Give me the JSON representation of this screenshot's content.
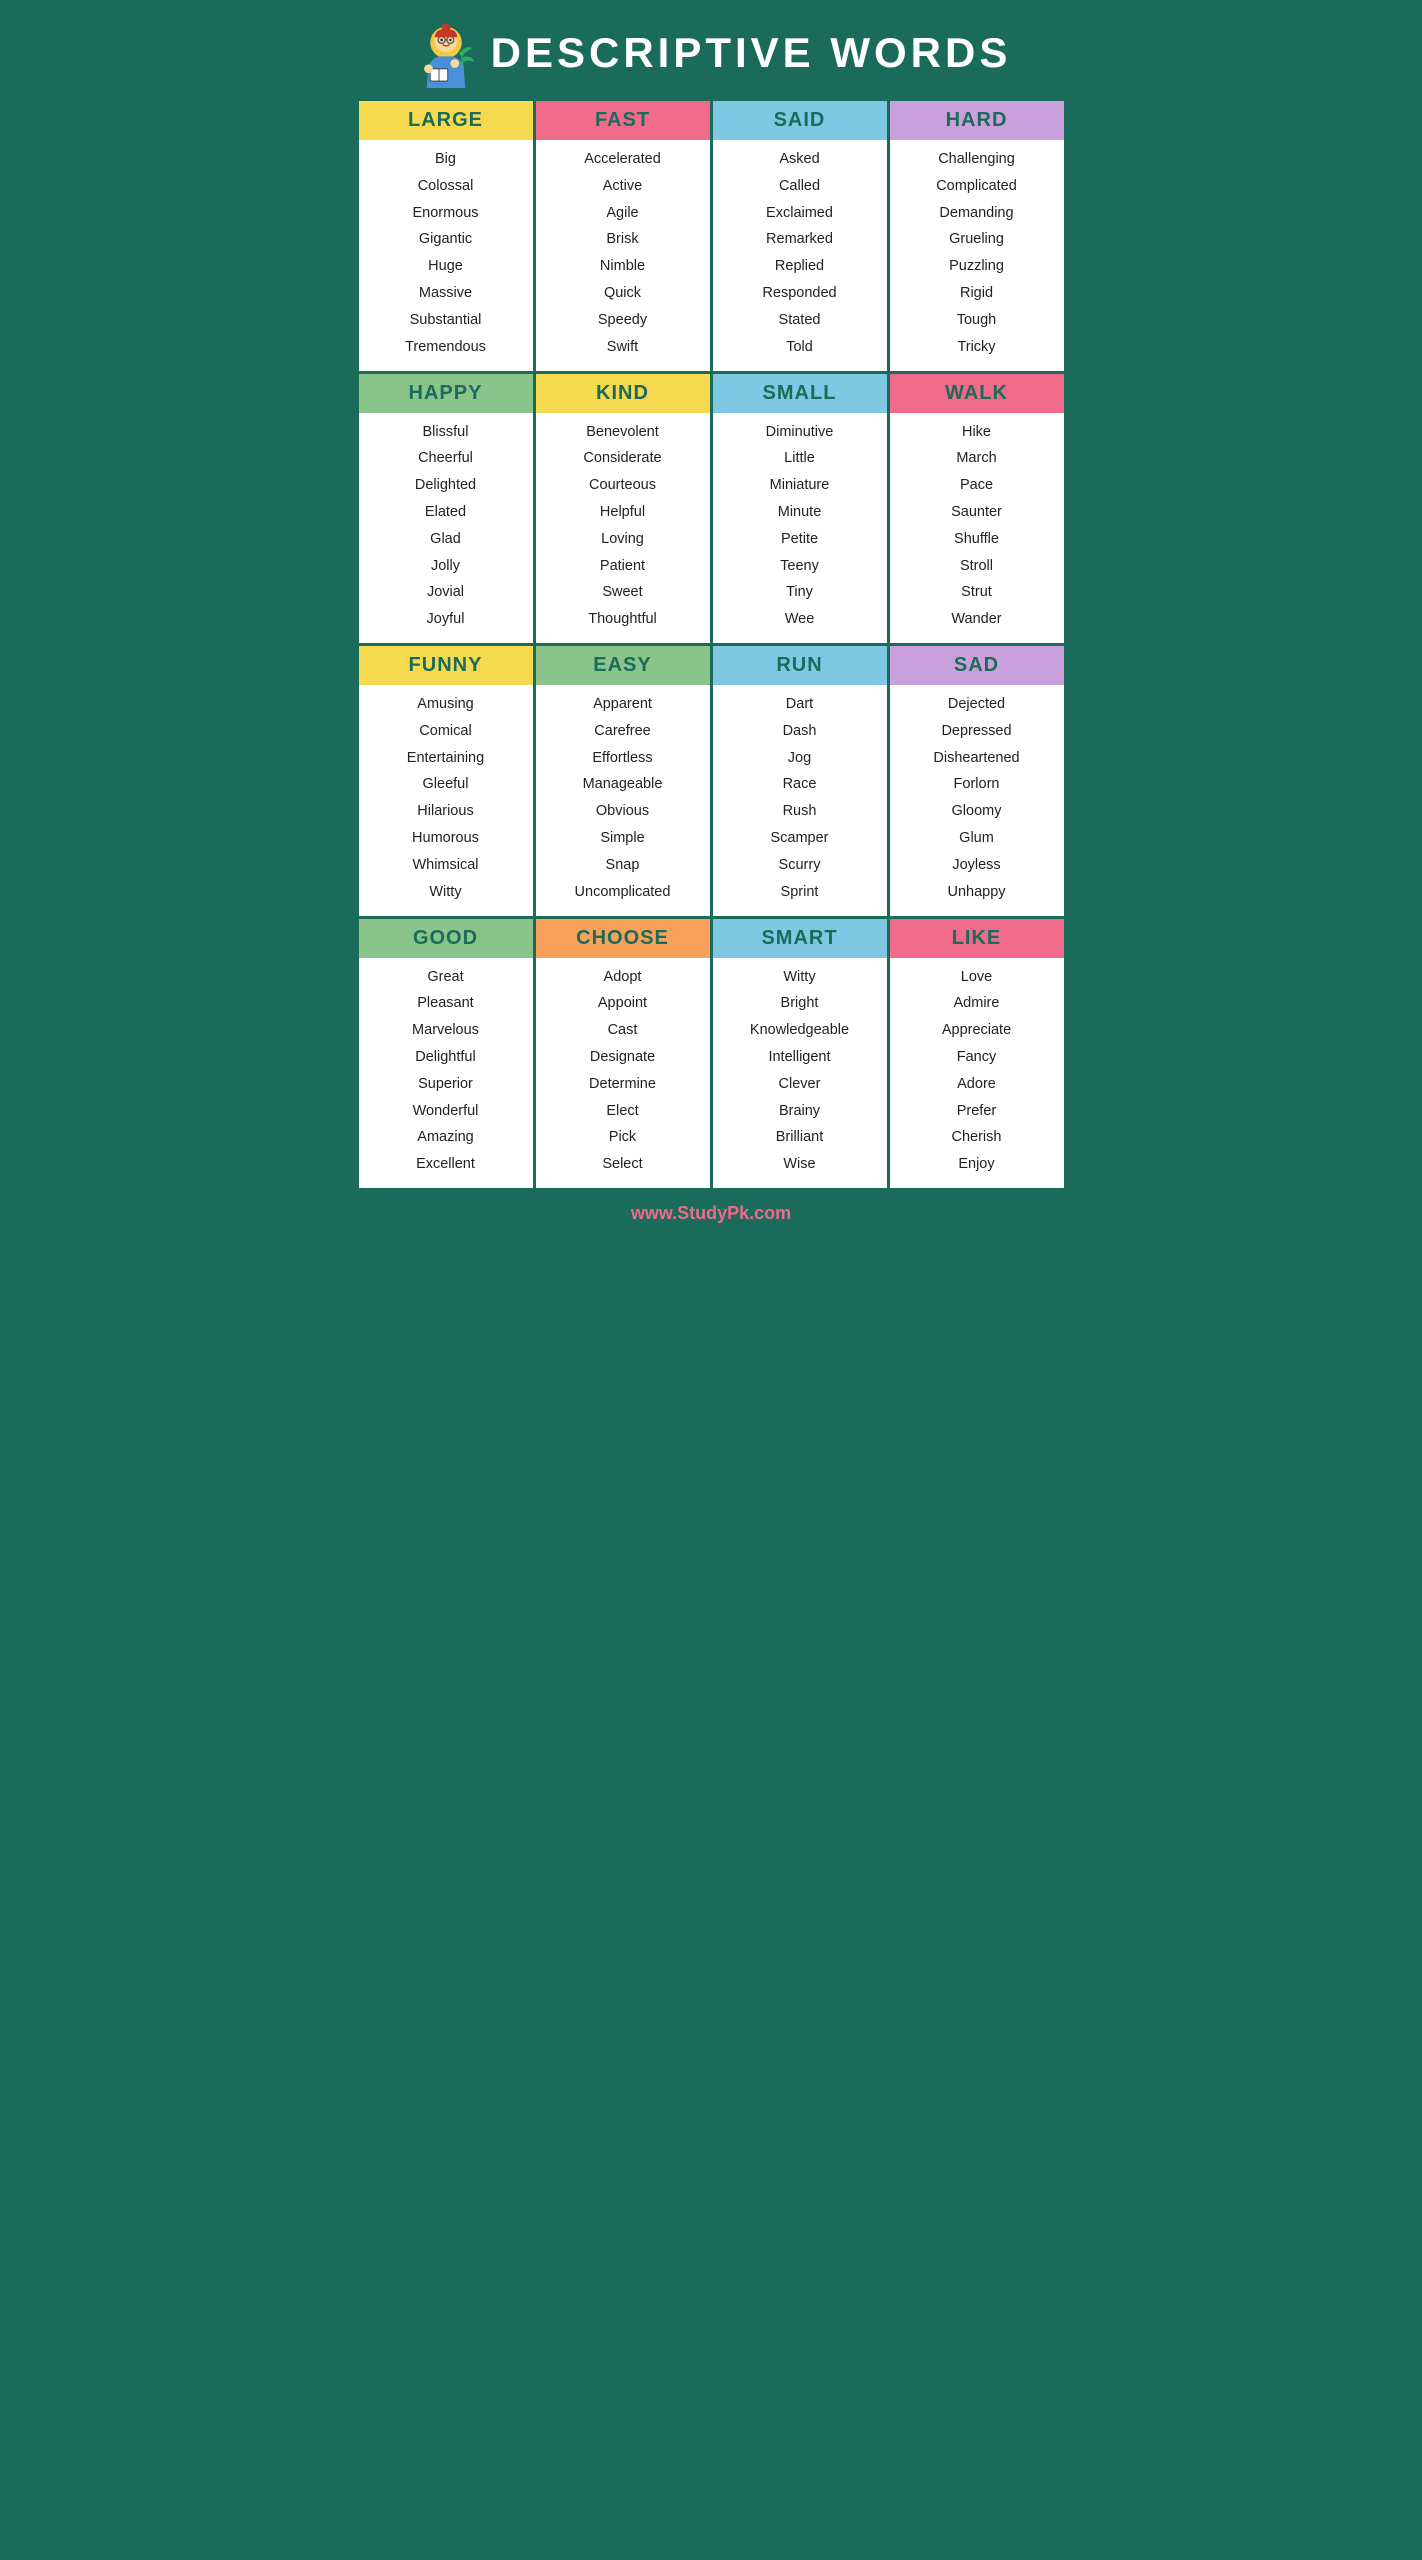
{
  "header": {
    "title": "DESCRIPTIVE WORDS"
  },
  "footer": {
    "url": "www.StudyPk.com"
  },
  "cells": [
    {
      "label": "LARGE",
      "color": "yellow",
      "words": [
        "Big",
        "Colossal",
        "Enormous",
        "Gigantic",
        "Huge",
        "Massive",
        "Substantial",
        "Tremendous"
      ]
    },
    {
      "label": "FAST",
      "color": "pink",
      "words": [
        "Accelerated",
        "Active",
        "Agile",
        "Brisk",
        "Nimble",
        "Quick",
        "Speedy",
        "Swift"
      ]
    },
    {
      "label": "SAID",
      "color": "blue",
      "words": [
        "Asked",
        "Called",
        "Exclaimed",
        "Remarked",
        "Replied",
        "Responded",
        "Stated",
        "Told"
      ]
    },
    {
      "label": "HARD",
      "color": "purple",
      "words": [
        "Challenging",
        "Complicated",
        "Demanding",
        "Grueling",
        "Puzzling",
        "Rigid",
        "Tough",
        "Tricky"
      ]
    },
    {
      "label": "HAPPY",
      "color": "green",
      "words": [
        "Blissful",
        "Cheerful",
        "Delighted",
        "Elated",
        "Glad",
        "Jolly",
        "Jovial",
        "Joyful"
      ]
    },
    {
      "label": "KIND",
      "color": "yellow",
      "words": [
        "Benevolent",
        "Considerate",
        "Courteous",
        "Helpful",
        "Loving",
        "Patient",
        "Sweet",
        "Thoughtful"
      ]
    },
    {
      "label": "SMALL",
      "color": "blue",
      "words": [
        "Diminutive",
        "Little",
        "Miniature",
        "Minute",
        "Petite",
        "Teeny",
        "Tiny",
        "Wee"
      ]
    },
    {
      "label": "WALK",
      "color": "pink",
      "words": [
        "Hike",
        "March",
        "Pace",
        "Saunter",
        "Shuffle",
        "Stroll",
        "Strut",
        "Wander"
      ]
    },
    {
      "label": "FUNNY",
      "color": "yellow",
      "words": [
        "Amusing",
        "Comical",
        "Entertaining",
        "Gleeful",
        "Hilarious",
        "Humorous",
        "Whimsical",
        "Witty"
      ]
    },
    {
      "label": "EASY",
      "color": "green",
      "words": [
        "Apparent",
        "Carefree",
        "Effortless",
        "Manageable",
        "Obvious",
        "Simple",
        "Snap",
        "Uncomplicated"
      ]
    },
    {
      "label": "RUN",
      "color": "blue",
      "words": [
        "Dart",
        "Dash",
        "Jog",
        "Race",
        "Rush",
        "Scamper",
        "Scurry",
        "Sprint"
      ]
    },
    {
      "label": "SAD",
      "color": "purple",
      "words": [
        "Dejected",
        "Depressed",
        "Disheartened",
        "Forlorn",
        "Gloomy",
        "Glum",
        "Joyless",
        "Unhappy"
      ]
    },
    {
      "label": "GOOD",
      "color": "green",
      "words": [
        "Great",
        "Pleasant",
        "Marvelous",
        "Delightful",
        "Superior",
        "Wonderful",
        "Amazing",
        "Excellent"
      ]
    },
    {
      "label": "CHOOSE",
      "color": "orange",
      "words": [
        "Adopt",
        "Appoint",
        "Cast",
        "Designate",
        "Determine",
        "Elect",
        "Pick",
        "Select"
      ]
    },
    {
      "label": "SMART",
      "color": "blue",
      "words": [
        "Witty",
        "Bright",
        "Knowledgeable",
        "Intelligent",
        "Clever",
        "Brainy",
        "Brilliant",
        "Wise"
      ]
    },
    {
      "label": "LIKE",
      "color": "pink",
      "words": [
        "Love",
        "Admire",
        "Appreciate",
        "Fancy",
        "Adore",
        "Prefer",
        "Cherish",
        "Enjoy"
      ]
    }
  ]
}
